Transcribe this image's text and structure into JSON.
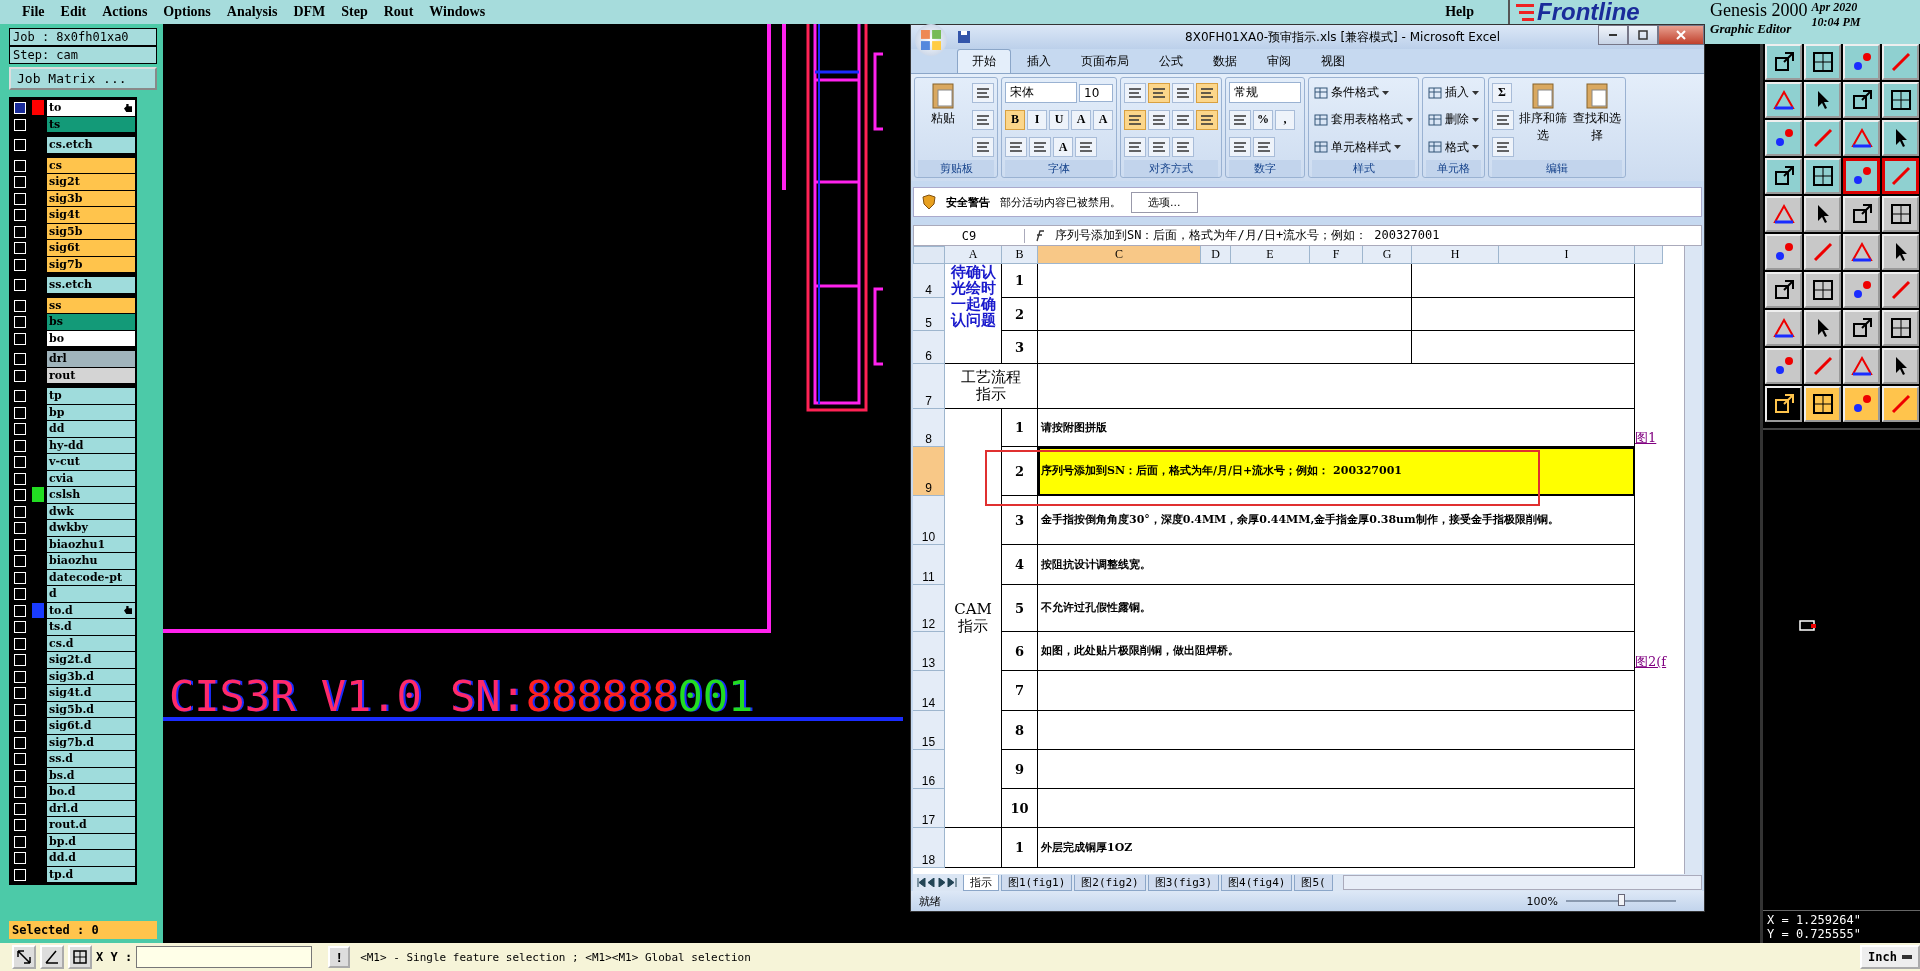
{
  "menu": {
    "items": [
      "File",
      "Edit",
      "Actions",
      "Options",
      "Analysis",
      "DFM",
      "Step",
      "Rout",
      "Windows"
    ],
    "help": "Help"
  },
  "brand": {
    "logo": "Frontline",
    "product": "Genesis 2000",
    "date": "Apr 2020",
    "time": "10:04 PM",
    "subtitle": "Graphic Editor"
  },
  "job": {
    "job": "Job : 8x0fh01xa0",
    "step": "Step: cam",
    "matrix_button": "Job Matrix ..."
  },
  "layer_groups": [
    {
      "layers": [
        {
          "name": "to",
          "color": "#ffffff",
          "swatch": {
            "color": "#ff0000"
          },
          "active": true,
          "marked": true
        },
        {
          "name": "ts",
          "color": "#139a78",
          "active": false,
          "marked": false
        }
      ]
    },
    {
      "layers": [
        {
          "name": "cs.etch",
          "color": "#9fdcdc",
          "active": false,
          "marked": false
        }
      ]
    },
    {
      "layers": [
        {
          "name": "cs",
          "color": "#ffc44c",
          "active": false,
          "marked": false
        },
        {
          "name": "sig2t",
          "color": "#ffc44c",
          "active": false,
          "marked": false
        },
        {
          "name": "sig3b",
          "color": "#ffc44c",
          "active": false,
          "marked": false
        },
        {
          "name": "sig4t",
          "color": "#ffc44c",
          "active": false,
          "marked": false
        },
        {
          "name": "sig5b",
          "color": "#ffc44c",
          "active": false,
          "marked": false
        },
        {
          "name": "sig6t",
          "color": "#ffc44c",
          "active": false,
          "marked": false
        },
        {
          "name": "sig7b",
          "color": "#ffc44c",
          "active": false,
          "marked": false
        }
      ]
    },
    {
      "layers": [
        {
          "name": "ss.etch",
          "color": "#9fdcdc",
          "active": false,
          "marked": false
        }
      ]
    },
    {
      "layers": [
        {
          "name": "ss",
          "color": "#ffc44c",
          "active": false,
          "marked": false
        },
        {
          "name": "bs",
          "color": "#139a78",
          "active": false,
          "marked": false
        },
        {
          "name": "bo",
          "color": "#ffffff",
          "active": false,
          "marked": false
        }
      ]
    },
    {
      "layers": [
        {
          "name": "drl",
          "color": "#a0b4bc",
          "active": false,
          "marked": false
        },
        {
          "name": "rout",
          "color": "#d4d4d4",
          "active": false,
          "marked": false
        }
      ]
    },
    {
      "layers": [
        {
          "name": "tp",
          "color": "#9fdcdc",
          "active": false,
          "marked": false
        },
        {
          "name": "bp",
          "color": "#9fdcdc",
          "active": false,
          "marked": false
        },
        {
          "name": "dd",
          "color": "#9fdcdc",
          "active": false,
          "marked": false
        },
        {
          "name": "hy-dd",
          "color": "#9fdcdc",
          "active": false,
          "marked": false
        },
        {
          "name": "v-cut",
          "color": "#9fdcdc",
          "active": false,
          "marked": false
        },
        {
          "name": "cvia",
          "color": "#9fdcdc",
          "active": false,
          "marked": false
        },
        {
          "name": "cslsh",
          "color": "#9fdcdc",
          "swatch": {
            "color": "#22dd22"
          },
          "active": false,
          "marked": false
        },
        {
          "name": "dwk",
          "color": "#9fdcdc",
          "active": false,
          "marked": false
        },
        {
          "name": "dwkby",
          "color": "#9fdcdc",
          "active": false,
          "marked": false
        },
        {
          "name": "biaozhu1",
          "color": "#9fdcdc",
          "active": false,
          "marked": false
        },
        {
          "name": "biaozhu",
          "color": "#9fdcdc",
          "active": false,
          "marked": false
        },
        {
          "name": "datecode-pt",
          "color": "#9fdcdc",
          "active": false,
          "marked": false
        },
        {
          "name": "d",
          "color": "#9fdcdc",
          "active": false,
          "marked": false
        },
        {
          "name": "to.d",
          "color": "#9fdcdc",
          "swatch": {
            "color": "#1a3cff"
          },
          "active": false,
          "marked": true
        },
        {
          "name": "ts.d",
          "color": "#9fdcdc",
          "active": false,
          "marked": false
        },
        {
          "name": "cs.d",
          "color": "#9fdcdc",
          "active": false,
          "marked": false
        },
        {
          "name": "sig2t.d",
          "color": "#9fdcdc",
          "active": false,
          "marked": false
        },
        {
          "name": "sig3b.d",
          "color": "#9fdcdc",
          "active": false,
          "marked": false
        },
        {
          "name": "sig4t.d",
          "color": "#9fdcdc",
          "active": false,
          "marked": false
        },
        {
          "name": "sig5b.d",
          "color": "#9fdcdc",
          "active": false,
          "marked": false
        },
        {
          "name": "sig6t.d",
          "color": "#9fdcdc",
          "active": false,
          "marked": false
        },
        {
          "name": "sig7b.d",
          "color": "#9fdcdc",
          "active": false,
          "marked": false
        },
        {
          "name": "ss.d",
          "color": "#9fdcdc",
          "active": false,
          "marked": false
        },
        {
          "name": "bs.d",
          "color": "#9fdcdc",
          "active": false,
          "marked": false
        },
        {
          "name": "bo.d",
          "color": "#9fdcdc",
          "active": false,
          "marked": false
        },
        {
          "name": "drl.d",
          "color": "#9fdcdc",
          "active": false,
          "marked": false
        },
        {
          "name": "rout.d",
          "color": "#9fdcdc",
          "active": false,
          "marked": false
        },
        {
          "name": "bp.d",
          "color": "#9fdcdc",
          "active": false,
          "marked": false
        },
        {
          "name": "dd.d",
          "color": "#9fdcdc",
          "active": false,
          "marked": false
        },
        {
          "name": "tp.d",
          "color": "#9fdcdc",
          "active": false,
          "marked": false
        }
      ]
    }
  ],
  "selected_count": "Selected : 0",
  "canvas_text": [
    {
      "text": "CIS3R V1.0",
      "color": "#ff2a6a"
    },
    {
      "text": "SN:",
      "color": "#ff2a6a"
    },
    {
      "text": "888888",
      "color": "#ff2020"
    },
    {
      "text": "001",
      "color": "#22dd22"
    }
  ],
  "excel": {
    "title": "8X0FH01XA0-预审指示.xls  [兼容模式] - Microsoft Excel",
    "tabs": [
      {
        "label": "开始",
        "selected": true
      },
      {
        "label": "插入",
        "selected": false
      },
      {
        "label": "页面布局",
        "selected": false
      },
      {
        "label": "公式",
        "selected": false
      },
      {
        "label": "数据",
        "selected": false
      },
      {
        "label": "审阅",
        "selected": false
      },
      {
        "label": "视图",
        "selected": false
      }
    ],
    "groups": [
      {
        "label": "剪贴板",
        "items": [
          {
            "kind": "big",
            "label": "粘贴"
          },
          {
            "kind": "stack",
            "rows": [
              [
                {
                  "kind": "icon",
                  "selected": false
                }
              ],
              [
                {
                  "kind": "icon",
                  "selected": false
                }
              ],
              [
                {
                  "kind": "icon",
                  "selected": false
                }
              ]
            ]
          }
        ]
      },
      {
        "label": "字体",
        "items": [
          {
            "kind": "stack",
            "rows": [
              [
                {
                  "kind": "dropdown",
                  "value": "宋体"
                },
                {
                  "kind": "dropdown",
                  "value": "10"
                }
              ],
              [
                {
                  "kind": "glyph",
                  "text": "B",
                  "selected": true
                },
                {
                  "kind": "glyph",
                  "text": "I",
                  "selected": false
                },
                {
                  "kind": "glyph",
                  "text": "U",
                  "selected": false
                },
                {
                  "kind": "glyph",
                  "text": "A",
                  "selected": false
                },
                {
                  "kind": "glyph",
                  "text": "A",
                  "selected": false
                }
              ],
              [
                {
                  "kind": "icon",
                  "selected": false
                },
                {
                  "kind": "icon",
                  "selected": false
                },
                {
                  "kind": "glyph",
                  "text": "A",
                  "selected": false
                },
                {
                  "kind": "icon",
                  "selected": false
                }
              ]
            ]
          }
        ]
      },
      {
        "label": "对齐方式",
        "items": [
          {
            "kind": "stack",
            "rows": [
              [
                {
                  "kind": "icon",
                  "selected": false
                },
                {
                  "kind": "icon",
                  "selected": true
                },
                {
                  "kind": "icon",
                  "selected": false
                },
                {
                  "kind": "icon",
                  "selected": true
                }
              ],
              [
                {
                  "kind": "icon",
                  "selected": true
                },
                {
                  "kind": "icon",
                  "selected": false
                },
                {
                  "kind": "icon",
                  "selected": false
                },
                {
                  "kind": "icon",
                  "selected": true
                }
              ],
              [
                {
                  "kind": "icon",
                  "selected": false
                },
                {
                  "kind": "icon",
                  "selected": false
                },
                {
                  "kind": "icon",
                  "selected": false
                }
              ]
            ]
          }
        ]
      },
      {
        "label": "数字",
        "items": [
          {
            "kind": "stack",
            "rows": [
              [
                {
                  "kind": "dropdown",
                  "value": "常规"
                }
              ],
              [
                {
                  "kind": "icon",
                  "selected": false
                },
                {
                  "kind": "glyph",
                  "text": "%",
                  "selected": false
                },
                {
                  "kind": "glyph",
                  "text": ",",
                  "selected": false
                }
              ],
              [
                {
                  "kind": "icon",
                  "selected": false
                },
                {
                  "kind": "icon",
                  "selected": false
                }
              ]
            ]
          }
        ]
      },
      {
        "label": "样式",
        "items": [
          {
            "kind": "stack",
            "rows": [
              [
                {
                  "kind": "labeled",
                  "label": "条件格式"
                }
              ],
              [
                {
                  "kind": "labeled",
                  "label": "套用表格格式"
                }
              ],
              [
                {
                  "kind": "labeled",
                  "label": "单元格样式"
                }
              ]
            ]
          }
        ]
      },
      {
        "label": "单元格",
        "items": [
          {
            "kind": "stack",
            "rows": [
              [
                {
                  "kind": "labeled",
                  "label": "插入"
                }
              ],
              [
                {
                  "kind": "labeled",
                  "label": "删除"
                }
              ],
              [
                {
                  "kind": "labeled",
                  "label": "格式"
                }
              ]
            ]
          }
        ]
      },
      {
        "label": "编辑",
        "items": [
          {
            "kind": "stack",
            "rows": [
              [
                {
                  "kind": "glyph",
                  "text": "Σ",
                  "selected": false
                }
              ],
              [
                {
                  "kind": "icon",
                  "selected": false
                }
              ],
              [
                {
                  "kind": "icon",
                  "selected": false
                }
              ]
            ]
          },
          {
            "kind": "big",
            "label": "排序和筛选"
          },
          {
            "kind": "big",
            "label": "查找和选择"
          }
        ]
      }
    ],
    "security": {
      "title": "安全警告",
      "message": "部分活动内容已被禁用。",
      "button": "选项..."
    },
    "name_box": "C9",
    "formula": "序列号添加到SN：后面，格式为年/月/日+流水号；例如：  200327001",
    "columns": [
      {
        "label": "A",
        "selected": false
      },
      {
        "label": "B",
        "selected": false
      },
      {
        "label": "C",
        "selected": true
      },
      {
        "label": "D",
        "selected": false
      },
      {
        "label": "E",
        "selected": false
      },
      {
        "label": "F",
        "selected": false
      },
      {
        "label": "G",
        "selected": false
      },
      {
        "label": "H",
        "selected": false
      },
      {
        "label": "I",
        "selected": false
      }
    ],
    "rows": [
      {
        "number": "4",
        "selected": false
      },
      {
        "number": "5",
        "selected": false
      },
      {
        "number": "6",
        "selected": false
      },
      {
        "number": "7",
        "selected": false
      },
      {
        "number": "8",
        "selected": false
      },
      {
        "number": "9",
        "selected": true
      },
      {
        "number": "10",
        "selected": false
      },
      {
        "number": "11",
        "selected": false
      },
      {
        "number": "12",
        "selected": false
      },
      {
        "number": "13",
        "selected": false
      },
      {
        "number": "14",
        "selected": false
      },
      {
        "number": "15",
        "selected": false
      },
      {
        "number": "16",
        "selected": false
      },
      {
        "number": "17",
        "selected": false
      },
      {
        "number": "18",
        "selected": false
      }
    ],
    "sections": [
      {
        "title": "待确认光绘时一起确认问题",
        "kind": "heading",
        "items": [
          {
            "number": "1",
            "selected": false
          },
          {
            "number": "2",
            "selected": false
          },
          {
            "number": "3",
            "selected": false
          }
        ]
      },
      {
        "title": "工艺流程指示",
        "kind": "label"
      },
      {
        "title": "CAM 指示",
        "kind": "label",
        "items": [
          {
            "number": "1",
            "text": "请按附图拼版",
            "link": "图1",
            "selected": false
          },
          {
            "number": "2",
            "text": "序列号添加到SN：后面，格式为年/月/日+流水号；例如：  200327001",
            "color": "#ffff00",
            "selected": true
          },
          {
            "number": "3",
            "text": "金手指按倒角角度30°，深度0.4MM，余厚0.44MM,金手指金厚0.38um制作，接受金手指极限削铜。",
            "selected": false
          },
          {
            "number": "4",
            "text": "按阻抗设计调整线宽。",
            "selected": false
          },
          {
            "number": "5",
            "text": "不允许过孔假性露铜。",
            "selected": false
          },
          {
            "number": "6",
            "text": "如图，此处贴片极限削铜，做出阻焊桥。",
            "link": "图2(f",
            "selected": false
          },
          {
            "number": "7",
            "selected": false
          },
          {
            "number": "8",
            "selected": false
          },
          {
            "number": "9",
            "selected": false
          },
          {
            "number": "10",
            "selected": false
          }
        ]
      },
      {
        "kind": "label",
        "items": [
          {
            "number": "1",
            "text": "外层完成铜厚1OZ",
            "selected": false
          }
        ]
      }
    ],
    "sheet_tabs": [
      {
        "label": "指示",
        "selected": true
      },
      {
        "label": "图1(fig1)",
        "selected": false
      },
      {
        "label": "图2(fig2)",
        "selected": false
      },
      {
        "label": "图3(fig3)",
        "selected": false
      },
      {
        "label": "图4(fig4)",
        "selected": false
      },
      {
        "label": "图5(",
        "selected": false
      }
    ],
    "status": "就绪",
    "zoom": "100%",
    "zoom_slider": {
      "level": 0.5
    }
  },
  "tools": [
    {
      "kind": "view",
      "selected": false
    },
    {
      "kind": "view",
      "selected": false
    },
    {
      "kind": "view",
      "selected": false
    },
    {
      "kind": "view",
      "selected": false
    },
    {
      "kind": "view",
      "selected": false
    },
    {
      "kind": "view",
      "selected": false
    },
    {
      "kind": "view",
      "selected": false
    },
    {
      "kind": "view",
      "selected": false
    },
    {
      "kind": "view",
      "selected": false
    },
    {
      "kind": "view",
      "selected": false
    },
    {
      "kind": "view",
      "selected": false
    },
    {
      "kind": "view",
      "selected": false
    },
    {
      "kind": "view",
      "selected": false
    },
    {
      "kind": "view",
      "selected": false
    },
    {
      "kind": "view",
      "selected": true
    },
    {
      "kind": "view",
      "selected": true
    },
    {
      "kind": "edit",
      "selected": false
    },
    {
      "kind": "edit",
      "selected": false
    },
    {
      "kind": "edit",
      "selected": false
    },
    {
      "kind": "edit",
      "selected": false
    },
    {
      "kind": "edit",
      "selected": false
    },
    {
      "kind": "edit",
      "selected": false
    },
    {
      "kind": "edit",
      "selected": false
    },
    {
      "kind": "edit",
      "selected": false
    },
    {
      "kind": "edit",
      "selected": false
    },
    {
      "kind": "edit",
      "selected": false
    },
    {
      "kind": "edit",
      "selected": false
    },
    {
      "kind": "edit",
      "selected": false
    },
    {
      "kind": "edit",
      "selected": false
    },
    {
      "kind": "edit",
      "selected": false
    },
    {
      "kind": "edit",
      "selected": false
    },
    {
      "kind": "edit",
      "selected": false
    },
    {
      "kind": "edit",
      "selected": false
    },
    {
      "kind": "edit",
      "selected": false
    },
    {
      "kind": "edit",
      "selected": false
    },
    {
      "kind": "edit",
      "selected": false
    },
    {
      "kind": "mode",
      "selected": true
    },
    {
      "kind": "mode",
      "selected": false
    },
    {
      "kind": "mode",
      "selected": false
    },
    {
      "kind": "mode",
      "selected": false
    }
  ],
  "coords": {
    "x": "X = 1.259264\"",
    "y": "Y = 0.725555\""
  },
  "bottom": {
    "xy_label": "X Y :",
    "bang": "!",
    "message": "<M1> - Single feature selection ; <M1><M1> Global selection",
    "units": "Inch"
  }
}
